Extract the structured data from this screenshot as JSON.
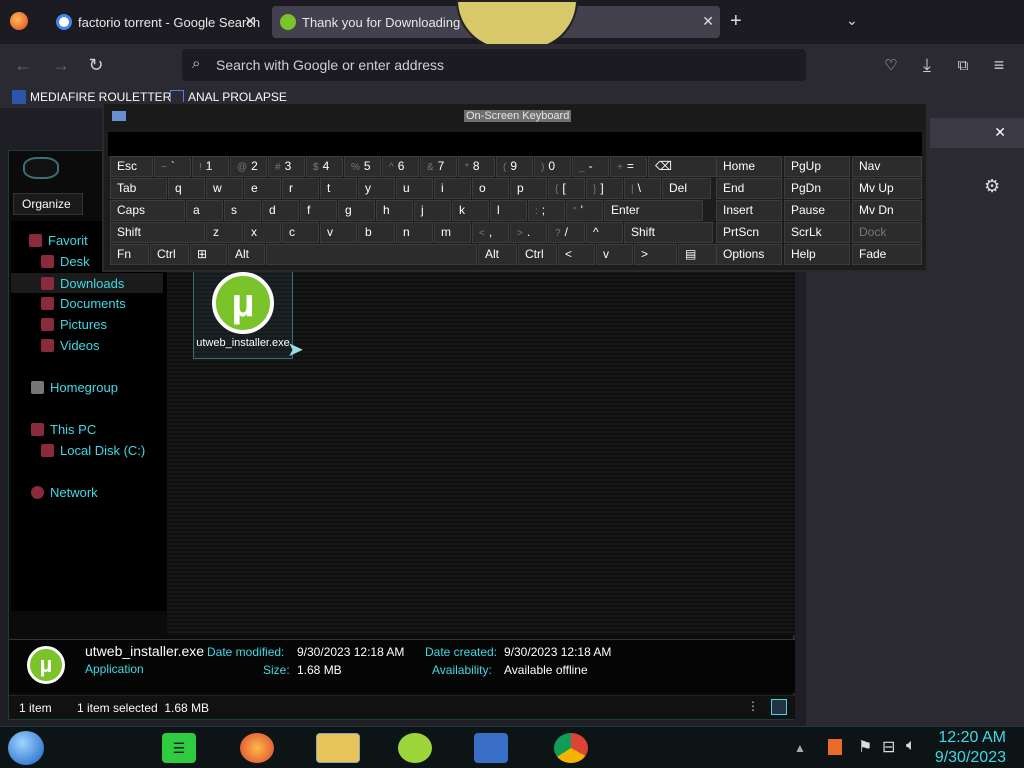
{
  "browser": {
    "tabs": [
      {
        "label": "factorio torrent - Google Search"
      },
      {
        "label": "Thank you for Downloading"
      }
    ],
    "new_tab_label": "+",
    "url_placeholder": "Search with Google or enter address",
    "bookmarks": [
      {
        "label": "MEDIAFIRE ROULETTER"
      },
      {
        "label": "ANAL PROLAPSE"
      }
    ]
  },
  "explorer": {
    "organize_label": "Organize",
    "sidebar": {
      "favorites": "Favorit",
      "desktop": "Desk",
      "downloads": "Downloads",
      "documents": "Documents",
      "pictures": "Pictures",
      "videos": "Videos",
      "homegroup": "Homegroup",
      "this_pc": "This PC",
      "local_disk": "Local Disk (C:)",
      "network": "Network"
    },
    "file": {
      "name": "utweb_installer.exe"
    },
    "details": {
      "name": "utweb_installer.exe",
      "type": "Application",
      "date_modified_label": "Date modified:",
      "date_modified": "9/30/2023 12:18 AM",
      "size_label": "Size:",
      "size": "1.68 MB",
      "date_created_label": "Date created:",
      "date_created": "9/30/2023 12:18 AM",
      "availability_label": "Availability:",
      "availability": "Available offline"
    },
    "status": {
      "count": "1 item",
      "selected": "1 item selected  1.68 MB"
    }
  },
  "osk": {
    "title": "On-Screen Keyboard",
    "rows": [
      [
        [
          "Esc",
          ""
        ],
        [
          "`",
          "~"
        ],
        [
          "1",
          "!"
        ],
        [
          "2",
          "@"
        ],
        [
          "3",
          "#"
        ],
        [
          "4",
          "$"
        ],
        [
          "5",
          "%"
        ],
        [
          "6",
          "^"
        ],
        [
          "7",
          "&"
        ],
        [
          "8",
          "*"
        ],
        [
          "9",
          "("
        ],
        [
          "0",
          ")"
        ],
        [
          "-",
          "_"
        ],
        [
          "=",
          "+"
        ],
        [
          "⌫",
          ""
        ]
      ],
      [
        [
          "Tab",
          ""
        ],
        [
          "q",
          ""
        ],
        [
          "w",
          ""
        ],
        [
          "e",
          ""
        ],
        [
          "r",
          ""
        ],
        [
          "t",
          ""
        ],
        [
          "y",
          ""
        ],
        [
          "u",
          ""
        ],
        [
          "i",
          ""
        ],
        [
          "o",
          ""
        ],
        [
          "p",
          ""
        ],
        [
          "[",
          "{"
        ],
        [
          "]",
          "}"
        ],
        [
          "\\",
          "|"
        ],
        [
          "Del",
          ""
        ]
      ],
      [
        [
          "Caps",
          ""
        ],
        [
          "a",
          ""
        ],
        [
          "s",
          ""
        ],
        [
          "d",
          ""
        ],
        [
          "f",
          ""
        ],
        [
          "g",
          ""
        ],
        [
          "h",
          ""
        ],
        [
          "j",
          ""
        ],
        [
          "k",
          ""
        ],
        [
          "l",
          ""
        ],
        [
          ";",
          ":"
        ],
        [
          "'",
          "\""
        ],
        [
          "Enter",
          ""
        ]
      ],
      [
        [
          "Shift",
          ""
        ],
        [
          "z",
          ""
        ],
        [
          "x",
          ""
        ],
        [
          "c",
          ""
        ],
        [
          "v",
          ""
        ],
        [
          "b",
          ""
        ],
        [
          "n",
          ""
        ],
        [
          "m",
          ""
        ],
        [
          ",",
          "<"
        ],
        [
          ".",
          ">"
        ],
        [
          "/",
          "?"
        ],
        [
          "^",
          ""
        ],
        [
          "Shift",
          ""
        ]
      ],
      [
        [
          "Fn",
          ""
        ],
        [
          "Ctrl",
          ""
        ],
        [
          "⊞",
          ""
        ],
        [
          "Alt",
          ""
        ],
        [
          "",
          ""
        ],
        [
          "Alt",
          ""
        ],
        [
          "Ctrl",
          ""
        ],
        [
          "<",
          ""
        ],
        [
          "v",
          ""
        ],
        [
          ">",
          ""
        ],
        [
          "▤",
          ""
        ]
      ]
    ],
    "nav": [
      [
        "Home",
        "PgUp",
        "Nav"
      ],
      [
        "End",
        "PgDn",
        "Mv Up"
      ],
      [
        "Insert",
        "Pause",
        "Mv Dn"
      ],
      [
        "PrtScn",
        "ScrLk",
        "Dock"
      ],
      [
        "Options",
        "Help",
        "Fade"
      ]
    ]
  },
  "taskbar": {
    "time": "12:20 AM",
    "date": "9/30/2023"
  },
  "colors": {
    "accent": "#3fd9e6",
    "utorrent": "#7bc32a"
  }
}
